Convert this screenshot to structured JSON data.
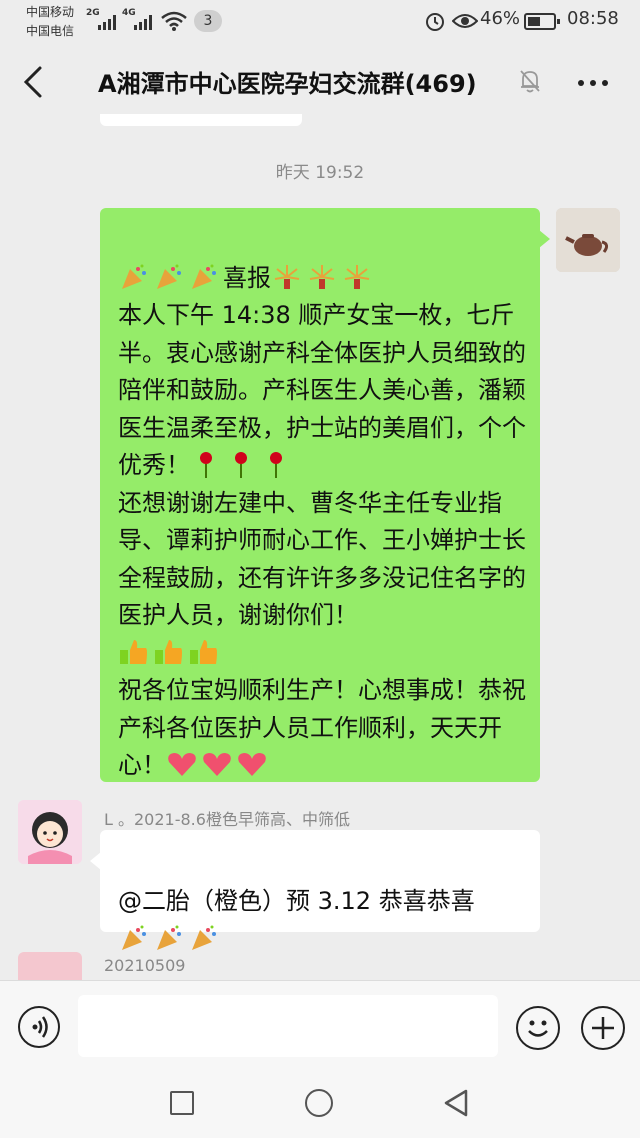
{
  "status_bar": {
    "carrier1": "中国移动",
    "carrier2": "中国电信",
    "net1": "2G",
    "net2": "4G",
    "notification_count": "3",
    "battery": "46%",
    "time": "08:58"
  },
  "header": {
    "title": "A湘潭市中心医院孕妇交流群(469)"
  },
  "chat": {
    "timestamp": "昨天 19:52",
    "my_message": {
      "line1": "喜报",
      "body": "本人下午 14:38 顺产女宝一枚，七斤半。衷心感谢产科全体医护人员细致的陪伴和鼓励。产科医生人美心善，潘颖医生温柔至极，护士站的美眉们，个个优秀！",
      "body2": "还想谢谢左建中、曹冬华主任专业指导、谭莉护师耐心工作、王小婵护士长全程鼓励，还有许许多多没记住名字的医护人员，谢谢你们！",
      "body3": "祝各位宝妈顺利生产！心想事成！恭祝产科各位医护人员工作顺利，天天开心！"
    },
    "reply": {
      "sender": "L 。2021-8.6橙色早筛高、中筛低",
      "text": "@二胎（橙色）预 3.12  恭喜恭喜"
    },
    "next_sender": "20210509"
  },
  "colors": {
    "my_bubble": "#95ec69",
    "other_bubble": "#ffffff",
    "background": "#ededed"
  }
}
